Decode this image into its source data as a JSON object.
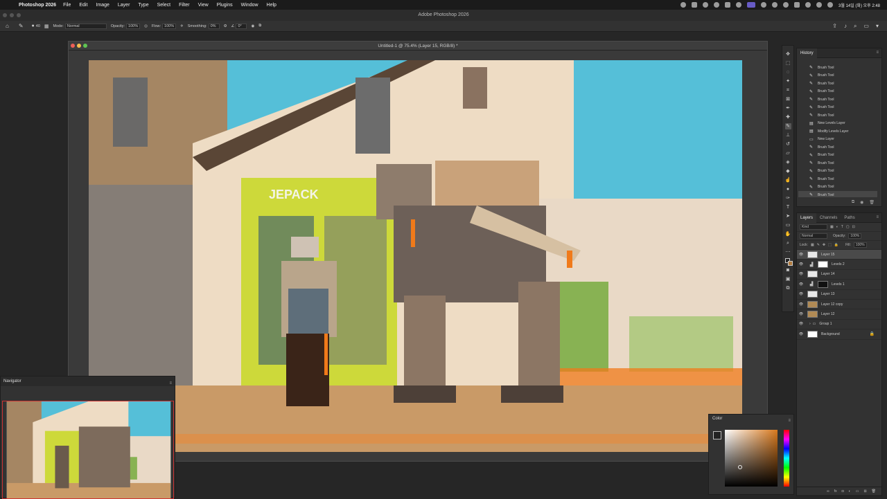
{
  "menubar": {
    "app": "Photoshop 2026",
    "items": [
      "File",
      "Edit",
      "Image",
      "Layer",
      "Type",
      "Select",
      "Filter",
      "View",
      "Plugins",
      "Window",
      "Help"
    ],
    "clock": "3월 14일 (화) 오후 2:48"
  },
  "app_title": "Adobe Photoshop 2026",
  "options": {
    "brush_size": "40",
    "mode_label": "Mode:",
    "mode_value": "Normal",
    "opacity_label": "Opacity:",
    "opacity_value": "100%",
    "flow_label": "Flow:",
    "flow_value": "100%",
    "smoothing_label": "Smoothing:",
    "smoothing_value": "0%",
    "angle_value": "0°"
  },
  "document": {
    "title": "Untitled-1 @ 75.4% (Layer 15, RGB/8) *",
    "sign_text": "JEPACK"
  },
  "history": {
    "tab": "History",
    "items": [
      {
        "icon": "brush-icon",
        "label": "Brush Tool"
      },
      {
        "icon": "brush-icon",
        "label": "Brush Tool"
      },
      {
        "icon": "brush-icon",
        "label": "Brush Tool"
      },
      {
        "icon": "brush-icon",
        "label": "Brush Tool"
      },
      {
        "icon": "brush-icon",
        "label": "Brush Tool"
      },
      {
        "icon": "brush-icon",
        "label": "Brush Tool"
      },
      {
        "icon": "brush-icon",
        "label": "Brush Tool"
      },
      {
        "icon": "levels-icon",
        "label": "New Levels Layer"
      },
      {
        "icon": "levels-icon",
        "label": "Modify Levels Layer"
      },
      {
        "icon": "layer-icon",
        "label": "New Layer"
      },
      {
        "icon": "brush-icon",
        "label": "Brush Tool"
      },
      {
        "icon": "brush-icon",
        "label": "Brush Tool"
      },
      {
        "icon": "brush-icon",
        "label": "Brush Tool"
      },
      {
        "icon": "brush-icon",
        "label": "Brush Tool"
      },
      {
        "icon": "brush-icon",
        "label": "Brush Tool"
      },
      {
        "icon": "brush-icon",
        "label": "Brush Tool"
      },
      {
        "icon": "brush-icon",
        "label": "Brush Tool"
      }
    ]
  },
  "layers": {
    "tabs": [
      "Layers",
      "Channels",
      "Paths"
    ],
    "kind_label": "Kind",
    "blend_mode": "Normal",
    "opacity_label": "Opacity:",
    "opacity_value": "100%",
    "lock_label": "Lock:",
    "fill_label": "Fill:",
    "fill_value": "100%",
    "items": [
      {
        "name": "Layer 15",
        "type": "pixel",
        "thumb": "#e8e8e8"
      },
      {
        "name": "Levels 2",
        "type": "adjustment",
        "thumb": "#ffffff"
      },
      {
        "name": "Layer 14",
        "type": "pixel",
        "thumb": "#e8e8e8"
      },
      {
        "name": "Levels 1",
        "type": "adjustment",
        "thumb": "#111111"
      },
      {
        "name": "Layer 13",
        "type": "pixel",
        "thumb": "#e8e8e8"
      },
      {
        "name": "Layer 12 copy",
        "type": "pixel",
        "thumb": "#b08a55"
      },
      {
        "name": "Layer 12",
        "type": "pixel",
        "thumb": "#b08a55"
      },
      {
        "name": "Group 1",
        "type": "group",
        "thumb": ""
      },
      {
        "name": "Background",
        "type": "background",
        "thumb": "#ffffff"
      }
    ]
  },
  "navigator": {
    "title": "Navigator"
  },
  "color_panel": {
    "title": "Color",
    "hue_color": "#d9791d"
  },
  "colors": {
    "sky": "#55bfd8",
    "wall": "#eed9bd",
    "shopfront": "#cdd93a",
    "street": "#c99a67",
    "accent_orange": "#f07a1a"
  }
}
